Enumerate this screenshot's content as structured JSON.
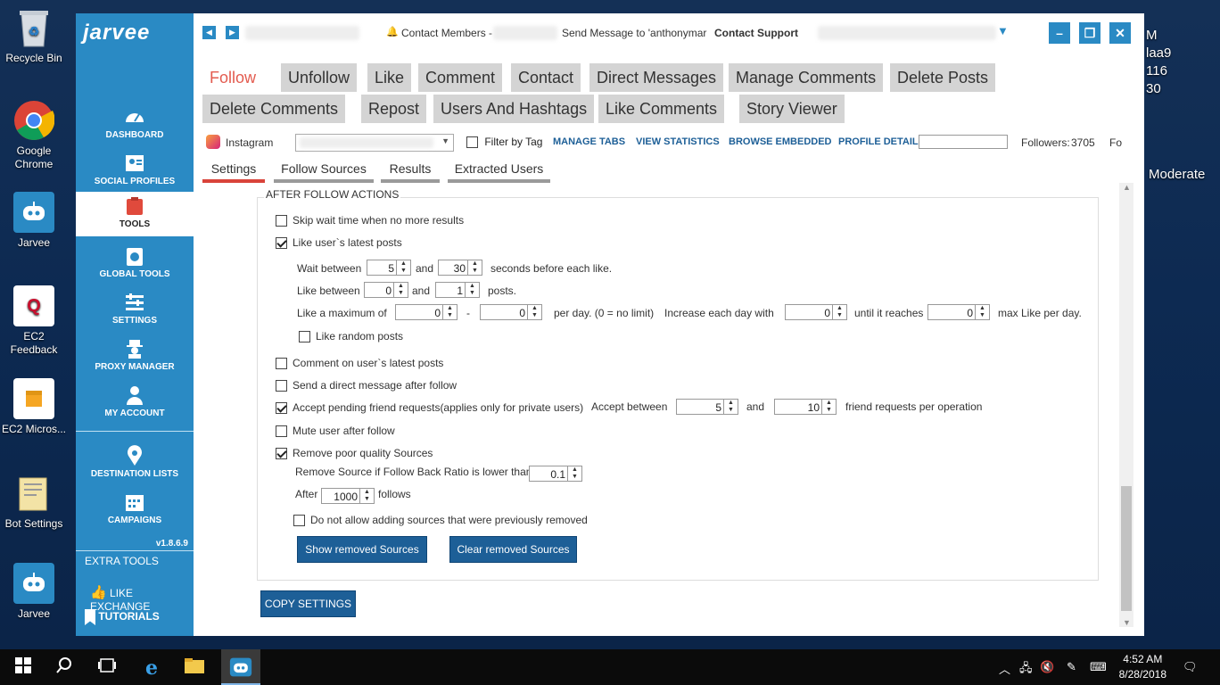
{
  "desktop": {
    "icons": [
      {
        "label": "Recycle Bin"
      },
      {
        "label": "Google Chrome"
      },
      {
        "label": "Jarvee"
      },
      {
        "label": "EC2 Feedback"
      },
      {
        "label": "EC2 Micros..."
      },
      {
        "label": "Bot Settings"
      },
      {
        "label": "Jarvee"
      }
    ],
    "right_text": [
      "M",
      "laa9",
      "116",
      "30"
    ],
    "moderate": "Moderate"
  },
  "app": {
    "logo": "jarvee",
    "version": "v1.8.6.9",
    "sidebar": [
      {
        "label": "DASHBOARD"
      },
      {
        "label": "SOCIAL PROFILES"
      },
      {
        "label": "TOOLS"
      },
      {
        "label": "GLOBAL TOOLS"
      },
      {
        "label": "SETTINGS"
      },
      {
        "label": "PROXY MANAGER"
      },
      {
        "label": "MY ACCOUNT"
      },
      {
        "label": "DESTINATION LISTS"
      },
      {
        "label": "CAMPAIGNS"
      }
    ],
    "extra_tools": "EXTRA TOOLS",
    "like_exchange": "LIKE EXCHANGE",
    "tutorials": "TUTORIALS",
    "titlebar": {
      "contact_members": "Contact Members -",
      "send_message": "Send Message to 'anthonymar",
      "contact_support": "Contact Support"
    },
    "tabs_row1": [
      "Follow",
      "Unfollow",
      "Like",
      "Comment",
      "Contact",
      "Direct Messages",
      "Manage Comments",
      "Delete Posts"
    ],
    "tabs_row2": [
      "Delete Comments",
      "Repost",
      "Users And Hashtags",
      "Like Comments",
      "Story Viewer"
    ],
    "toolbar": {
      "network": "Instagram",
      "filter_by_tag": "Filter by Tag",
      "manage_tabs": "MANAGE TABS",
      "view_statistics": "VIEW STATISTICS",
      "browse_embedded": "BROWSE EMBEDDED",
      "profile_details": "PROFILE DETAILS",
      "followers": "Followers:",
      "followers_count": "3705",
      "fo": "Fo"
    },
    "subtabs": [
      "Settings",
      "Follow Sources",
      "Results",
      "Extracted Users"
    ],
    "section_title": "AFTER FOLLOW ACTIONS",
    "options": {
      "skip_wait": "Skip wait time when no more results",
      "like_latest": "Like user`s latest posts",
      "wait_between": "Wait between",
      "wait_min": "5",
      "and": "and",
      "wait_max": "30",
      "seconds_before": "seconds before each like.",
      "like_between": "Like between",
      "like_min": "0",
      "like_max": "1",
      "posts": "posts.",
      "like_maximum_of": "Like a maximum of",
      "max_a": "0",
      "dash": "-",
      "max_b": "0",
      "per_day": "per day. (0 = no limit)",
      "increase_each_day": "Increase each day with",
      "increase_val": "0",
      "until_reaches": "until it reaches",
      "until_val": "0",
      "max_like_per_day": "max Like per day.",
      "like_random": "Like random posts",
      "comment_latest": "Comment on user`s latest posts",
      "send_dm": "Send a direct message after follow",
      "accept_pending": "Accept pending friend requests(applies only for private users)",
      "accept_between": "Accept between",
      "accept_min": "5",
      "accept_max": "10",
      "friend_requests": "friend requests per operation",
      "mute_user": "Mute user after follow",
      "remove_poor": "Remove poor quality Sources",
      "remove_source_if": "Remove Source if Follow Back Ratio is lower than",
      "ratio": "0.1",
      "after": "After",
      "after_val": "1000",
      "follows": "follows",
      "do_not_allow": "Do not allow adding sources that were previously removed",
      "show_removed": "Show removed Sources",
      "clear_removed": "Clear removed Sources",
      "copy_settings": "COPY SETTINGS"
    }
  },
  "taskbar": {
    "time": "4:52 AM",
    "date": "8/28/2018"
  }
}
